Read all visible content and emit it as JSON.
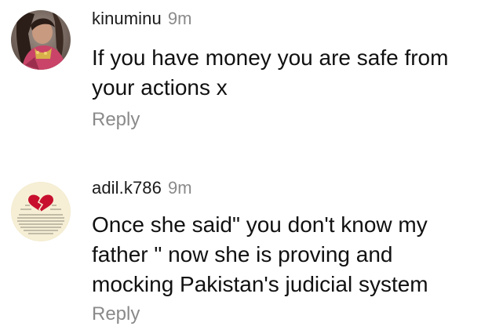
{
  "comments": [
    {
      "avatar_icon": "user-photo-avatar",
      "username": "kinuminu",
      "time": "9m",
      "text_lines": [
        "If you have money you are safe from",
        "your actions x"
      ],
      "reply_label": "Reply"
    },
    {
      "avatar_icon": "broken-heart-avatar",
      "username": "adil.k786",
      "time": "9m",
      "text_lines": [
        "Once she said\" you don't know my",
        "father \" now she is proving and",
        "mocking Pakistan's judicial system"
      ],
      "reply_label": "Reply"
    }
  ],
  "colors": {
    "text": "#111111",
    "meta": "#8a8a8a",
    "background": "#ffffff"
  }
}
